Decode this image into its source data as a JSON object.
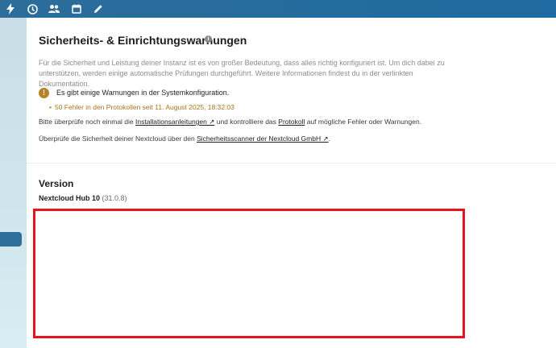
{
  "topbar": {
    "icons": [
      "bolt-icon",
      "activity-icon",
      "contacts-icon",
      "calendar-icon",
      "pencil-icon"
    ]
  },
  "security": {
    "title": "Sicherheits- & Einrichtungswarnungen",
    "intro": "Für die Sicherheit und Leistung deiner Instanz ist es von großer Bedeutung, dass alles richtig konfiguriert ist. Um dich dabei zu unterstützen, werden einige automatische Prüfungen durchgeführt. Weitere Informationen findest du in der verlinkten Dokumentation.",
    "warning": "Es gibt einige Warnungen in der Systemkonfiguration.",
    "error_item": "50 Fehler in den Protokollen seit 11. August 2025, 18:32:03",
    "para1_before": "Bitte überprüfe noch einmal die ",
    "para1_link1": "Installationsanleitungen ↗",
    "para1_middle": " und kontrolliere das ",
    "para1_link2": "Protokoll",
    "para1_after": " auf mögliche Fehler oder Warnungen.",
    "para2_before": "Überprüfe die Sicherheit deiner Nextcloud über den ",
    "para2_link": "Sicherheitsscanner der Nextcloud GmbH ↗",
    "para2_after": "."
  },
  "version": {
    "title": "Version",
    "product": "Nextcloud Hub 10",
    "number": "(31.0.8)"
  },
  "colors": {
    "topbar": "#1f6aa0",
    "warning": "#b58427",
    "highlight_box": "#e8141c"
  }
}
